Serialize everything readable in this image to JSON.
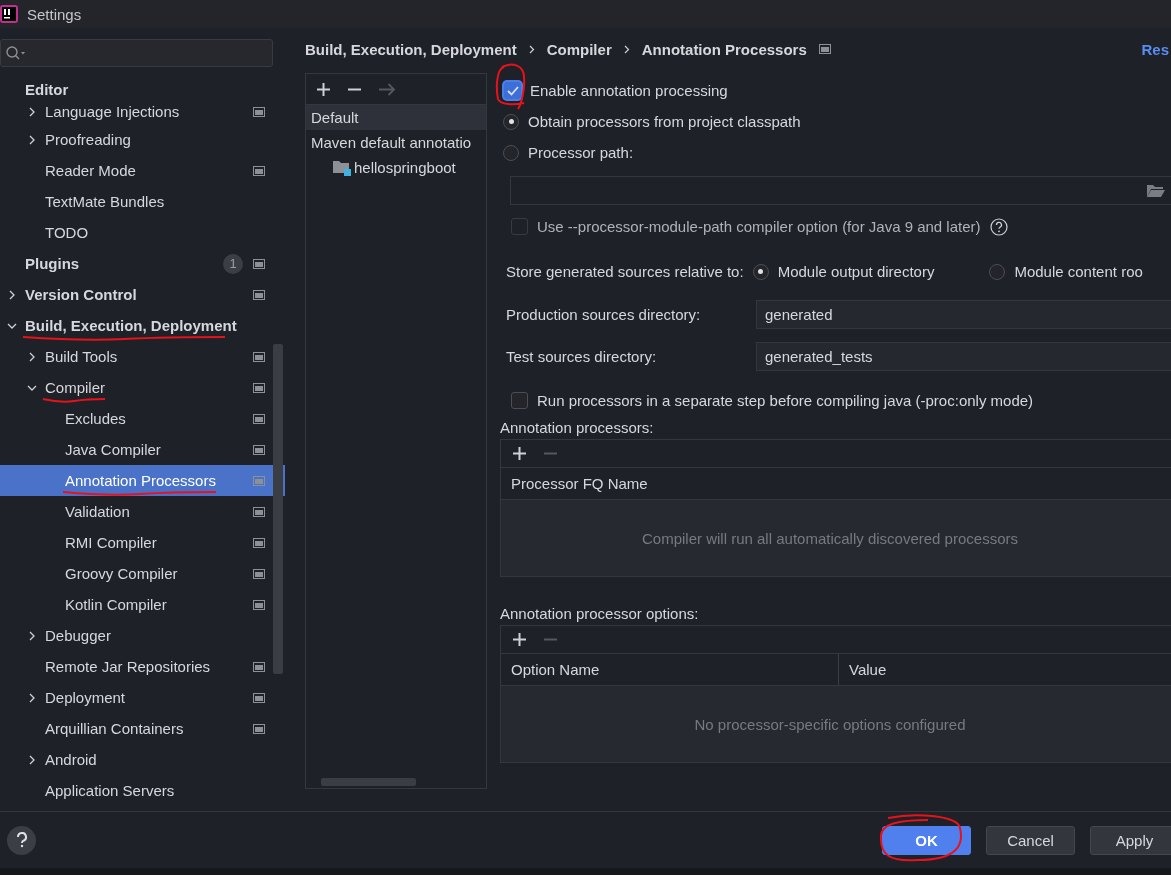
{
  "window": {
    "title": "Settings"
  },
  "sidebar": {
    "tree": [
      {
        "label": "Editor",
        "kind": "sticky",
        "children": [
          {
            "label": "Language Injections",
            "kind": "folder",
            "expanded": false,
            "project_icon": true,
            "marked": false
          },
          {
            "label": "Proofreading",
            "kind": "folder",
            "expanded": false,
            "project_icon": false,
            "marked": false
          },
          {
            "label": "Reader Mode",
            "kind": "page",
            "project_icon": true,
            "marked": false
          },
          {
            "label": "TextMate Bundles",
            "kind": "page",
            "project_icon": false,
            "marked": false
          },
          {
            "label": "TODO",
            "kind": "page",
            "project_icon": false,
            "marked": false
          }
        ]
      },
      {
        "label": "Plugins",
        "kind": "page",
        "badge": "1",
        "project_icon": true,
        "marked": false
      },
      {
        "label": "Version Control",
        "kind": "folder",
        "expanded": false,
        "project_icon": true,
        "marked": false
      },
      {
        "label": "Build, Execution, Deployment",
        "kind": "folder",
        "expanded": true,
        "project_icon": false,
        "marked": true,
        "children": [
          {
            "label": "Build Tools",
            "kind": "folder",
            "expanded": false,
            "project_icon": true,
            "marked": false
          },
          {
            "label": "Compiler",
            "kind": "folder",
            "expanded": true,
            "project_icon": true,
            "marked": true,
            "children": [
              {
                "label": "Excludes",
                "kind": "page",
                "project_icon": true,
                "marked": false,
                "selected": false
              },
              {
                "label": "Java Compiler",
                "kind": "page",
                "project_icon": true,
                "marked": false,
                "selected": false
              },
              {
                "label": "Annotation Processors",
                "kind": "page",
                "project_icon": true,
                "marked": true,
                "selected": true
              },
              {
                "label": "Validation",
                "kind": "page",
                "project_icon": true,
                "marked": false,
                "selected": false
              },
              {
                "label": "RMI Compiler",
                "kind": "page",
                "project_icon": true,
                "marked": false,
                "selected": false
              },
              {
                "label": "Groovy Compiler",
                "kind": "page",
                "project_icon": true,
                "marked": false,
                "selected": false
              },
              {
                "label": "Kotlin Compiler",
                "kind": "page",
                "project_icon": true,
                "marked": false,
                "selected": false
              }
            ]
          },
          {
            "label": "Debugger",
            "kind": "folder",
            "expanded": false,
            "project_icon": false,
            "marked": false
          },
          {
            "label": "Remote Jar Repositories",
            "kind": "page",
            "project_icon": true,
            "marked": false
          },
          {
            "label": "Deployment",
            "kind": "folder",
            "expanded": false,
            "project_icon": true,
            "marked": false
          },
          {
            "label": "Arquillian Containers",
            "kind": "page",
            "project_icon": true,
            "marked": false
          },
          {
            "label": "Android",
            "kind": "folder",
            "expanded": false,
            "project_icon": false,
            "marked": false
          },
          {
            "label": "Application Servers",
            "kind": "page",
            "project_icon": false,
            "marked": false
          }
        ]
      }
    ]
  },
  "breadcrumb": [
    "Build, Execution, Deployment",
    "Compiler",
    "Annotation Processors"
  ],
  "reset_link": "Res",
  "profiles": {
    "add_disabled": false,
    "remove_disabled": false,
    "move_disabled": true,
    "items": [
      {
        "label": "Default",
        "selected": true
      },
      {
        "label": "Maven default annotatio",
        "selected": false,
        "children": [
          {
            "label": "hellospringboot",
            "selected": false,
            "kind": "module"
          }
        ]
      }
    ]
  },
  "settings": {
    "enable": {
      "label": "Enable annotation processing",
      "checked": true,
      "marked": true
    },
    "source_options": [
      {
        "label": "Obtain processors from project classpath",
        "selected": true
      },
      {
        "label": "Processor path:",
        "selected": false
      }
    ],
    "processor_path": {
      "disabled": true
    },
    "module_path": {
      "label": "Use --processor-module-path compiler option (for Java 9 and later)",
      "checked": false,
      "disabled": true
    },
    "store_label": "Store generated sources relative to:",
    "store_options": [
      {
        "label": "Module output directory",
        "selected": true
      },
      {
        "label": "Module content roo",
        "selected": false
      }
    ],
    "production": {
      "label": "Production sources directory:",
      "value": "generated"
    },
    "test": {
      "label": "Test sources directory:",
      "value": "generated_tests"
    },
    "separate_step": {
      "label": "Run processors in a separate step before compiling java (-proc:only mode)",
      "checked": false
    },
    "processors": {
      "title": "Annotation processors:",
      "remove_disabled": true,
      "columns": [
        "Processor FQ Name"
      ],
      "empty": "Compiler will run all automatically discovered processors"
    },
    "options": {
      "title": "Annotation processor options:",
      "remove_disabled": true,
      "columns": [
        "Option Name",
        "Value"
      ],
      "empty": "No processor-specific options configured"
    }
  },
  "buttons": [
    {
      "label": "OK",
      "kind": "primary",
      "marked": true
    },
    {
      "label": "Cancel",
      "kind": "normal",
      "marked": false
    },
    {
      "label": "Apply",
      "kind": "normal",
      "marked": false
    }
  ]
}
